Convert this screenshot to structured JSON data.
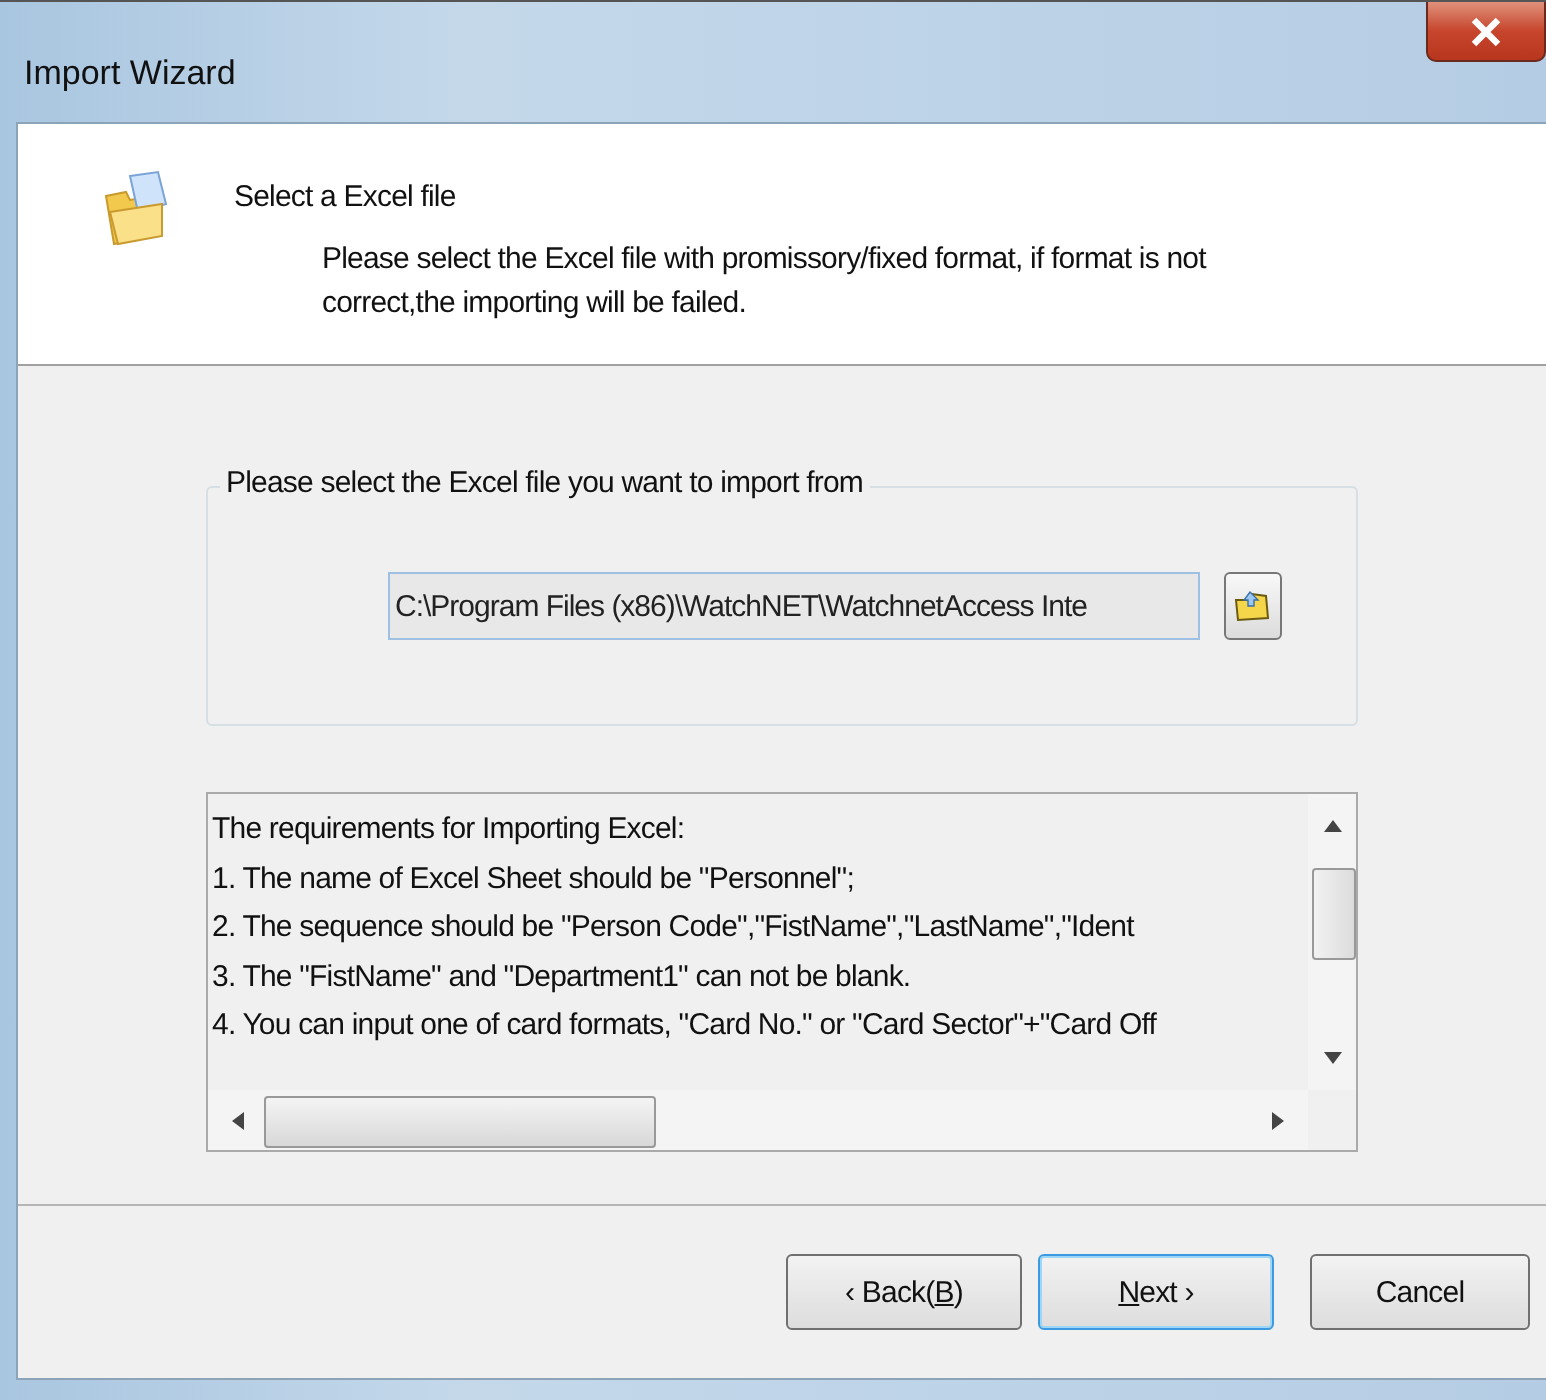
{
  "window": {
    "title": "Import Wizard"
  },
  "header": {
    "title": "Select a Excel file",
    "description": "Please select the Excel file with promissory/fixed format, if format is not correct,the importing will be failed."
  },
  "file_group": {
    "legend": "Please select the Excel file you want to import from",
    "path": "C:\\Program Files (x86)\\WatchNET\\WatchnetAccess Inte"
  },
  "requirements": [
    "The requirements for Importing Excel:",
    "1. The name of Excel Sheet should be \"Personnel\";",
    "2. The sequence should be \"Person Code\",\"FistName\",\"LastName\",\"Ident",
    "3. The \"FistName\" and \"Department1\" can not be blank.",
    "4. You can input one of card formats, \"Card No.\" or \"Card Sector\"+\"Card Off"
  ],
  "buttons": [
    {
      "before": "‹ Back(",
      "key": "B",
      "after": ")",
      "default": false
    },
    {
      "key": "N",
      "after": "ext ›",
      "default": true
    },
    {
      "before": "Cancel",
      "default": false
    }
  ]
}
